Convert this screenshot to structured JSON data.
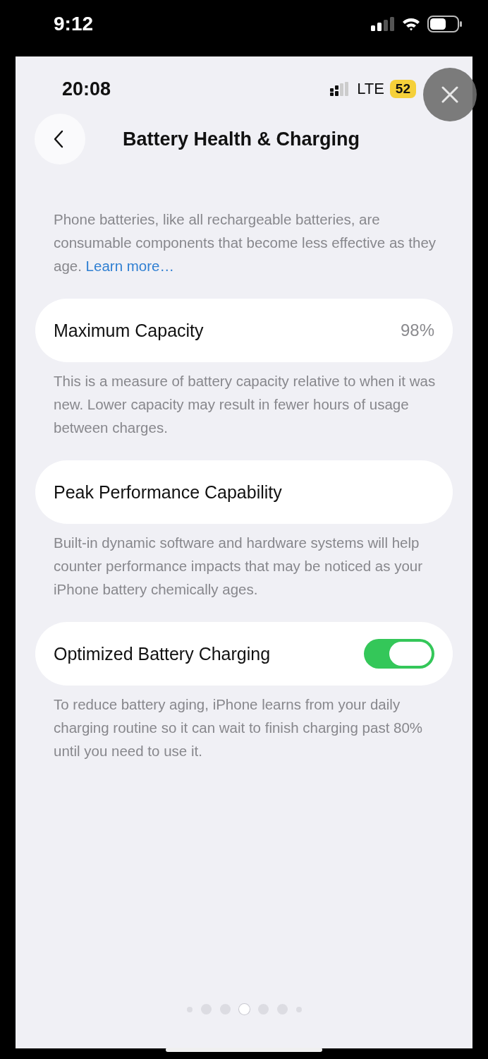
{
  "outer_status": {
    "time": "9:12"
  },
  "inner_status": {
    "time": "20:08",
    "network": "LTE",
    "battery": "52"
  },
  "nav": {
    "title": "Battery Health & Charging"
  },
  "intro": {
    "text": "Phone batteries, like all rechargeable batteries, are consumable components that become less effective as they age.",
    "link": "Learn more…"
  },
  "rows": [
    {
      "kind": "value",
      "label": "Maximum Capacity",
      "value": "98%",
      "footer": "This is a measure of battery capacity relative to when it was new. Lower capacity may result in fewer hours of usage between charges."
    },
    {
      "kind": "plain",
      "label": "Peak Performance Capability",
      "footer": "Built-in dynamic software and hardware systems will help counter performance impacts that may be noticed as your iPhone battery chemically ages."
    },
    {
      "kind": "toggle",
      "label": "Optimized Battery Charging",
      "on": true,
      "footer": "To reduce battery aging, iPhone learns from your daily charging routine so it can wait to finish charging past 80% until you need to use it."
    }
  ],
  "page_dots": [
    {
      "selected": false
    },
    {
      "selected": false
    },
    {
      "selected": false
    },
    {
      "selected": true
    },
    {
      "selected": false
    },
    {
      "selected": false
    },
    {
      "selected": false
    }
  ]
}
